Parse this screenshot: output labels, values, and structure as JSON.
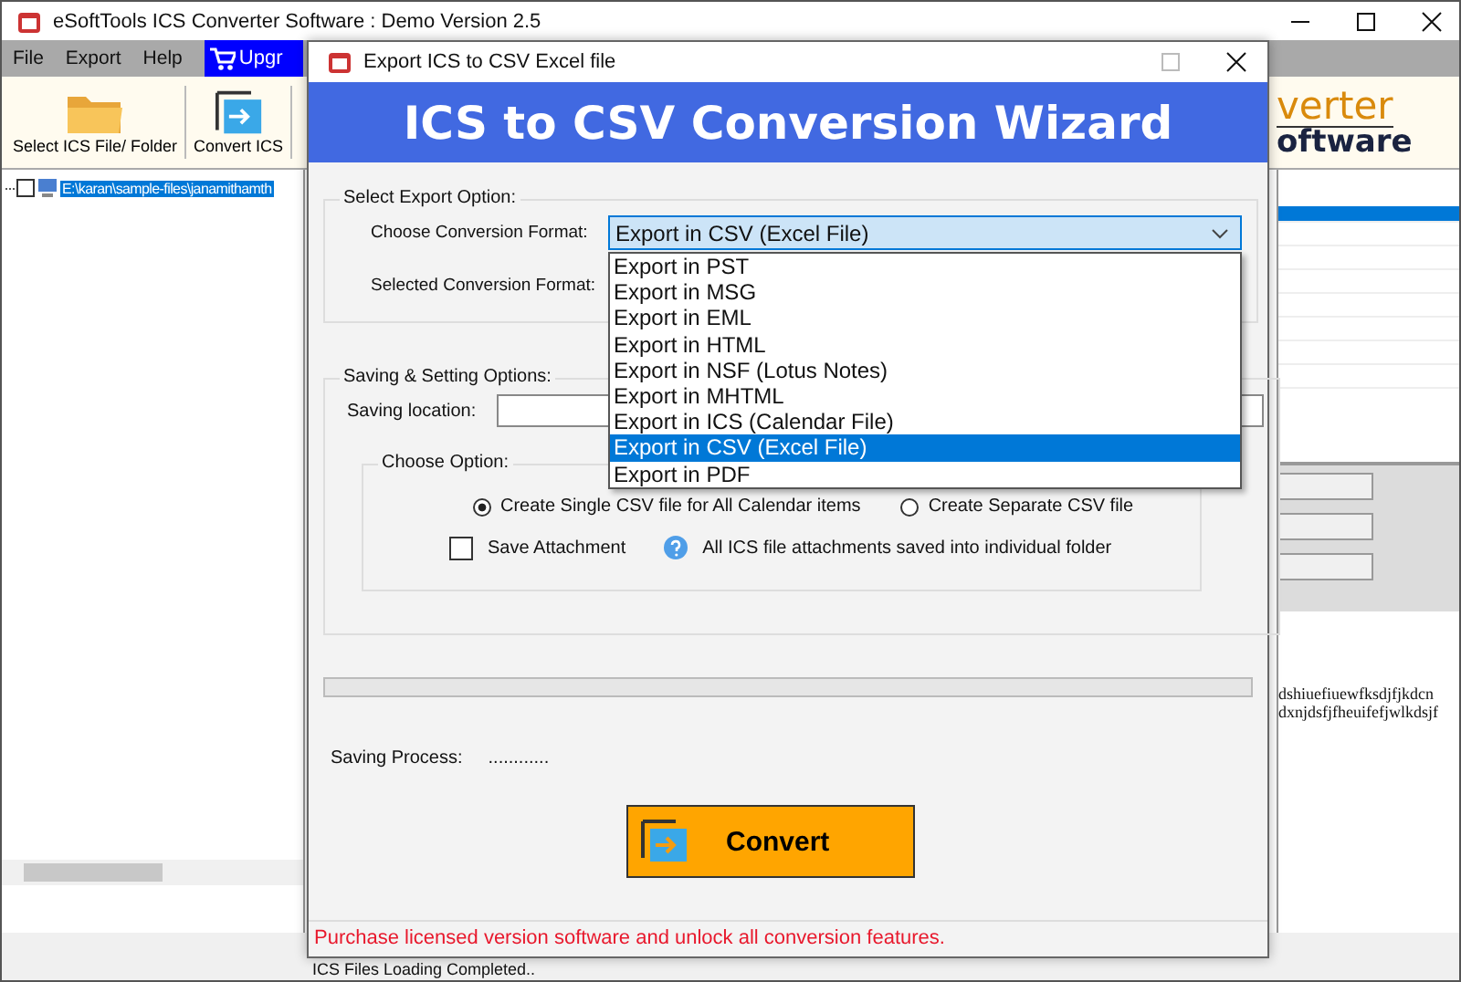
{
  "main_window": {
    "title": "eSoftTools ICS Converter Software : Demo Version 2.5",
    "menu": [
      {
        "label": "File"
      },
      {
        "label": "Export"
      },
      {
        "label": "Help"
      }
    ],
    "upgrade_button": "Upgr",
    "toolbar": [
      {
        "label": "Select ICS File/ Folder",
        "kind": "folder"
      },
      {
        "label": "Convert ICS",
        "kind": "convert"
      }
    ],
    "tree": [
      {
        "label": "E:\\karan\\sample-files\\janamithamth",
        "checked": false,
        "selected": true
      }
    ],
    "logo": {
      "line_1": "verter",
      "line_2": "oftware"
    },
    "preview_lines": [
      "dshiuefiuewfksdjfjkdcn",
      "dxnjdsfjfheuifefjwlkdsjf"
    ],
    "status": "ICS Files Loading Completed.."
  },
  "dialog": {
    "title": "Export ICS to CSV Excel file",
    "header": "ICS to CSV Conversion Wizard",
    "export_group": {
      "title": "Select Export Option:",
      "format_label": "Choose Conversion Format:",
      "format_value": "Export in CSV (Excel File)",
      "selected_label": "Selected Conversion Format:",
      "options": [
        {
          "label": "Export in PST",
          "selected": false
        },
        {
          "label": "Export in MSG",
          "selected": false
        },
        {
          "label": "Export in EML",
          "selected": false
        },
        {
          "label": "Export in HTML",
          "selected": false
        },
        {
          "label": "Export in NSF (Lotus Notes)",
          "selected": false
        },
        {
          "label": "Export in MHTML",
          "selected": false
        },
        {
          "label": "Export in ICS (Calendar File)",
          "selected": false
        },
        {
          "label": "Export in CSV (Excel File)",
          "selected": true
        },
        {
          "label": "Export in PDF",
          "selected": false
        }
      ]
    },
    "saving_group": {
      "title": "Saving & Setting Options:",
      "location_label": "Saving location:",
      "option_group_title": "Choose Option:",
      "radios": [
        {
          "label": "Create Single CSV file for All Calendar items",
          "selected": true
        },
        {
          "label": "Create Separate CSV file",
          "selected": false
        }
      ],
      "save_attachment": {
        "label": "Save Attachment",
        "checked": false
      },
      "hint": "All ICS file attachments saved into individual folder"
    },
    "progress": {
      "level": 0
    },
    "process_label": "Saving Process:",
    "process_value": "............",
    "convert_button": "Convert",
    "footer": "Purchase licensed version software and unlock all conversion features."
  }
}
